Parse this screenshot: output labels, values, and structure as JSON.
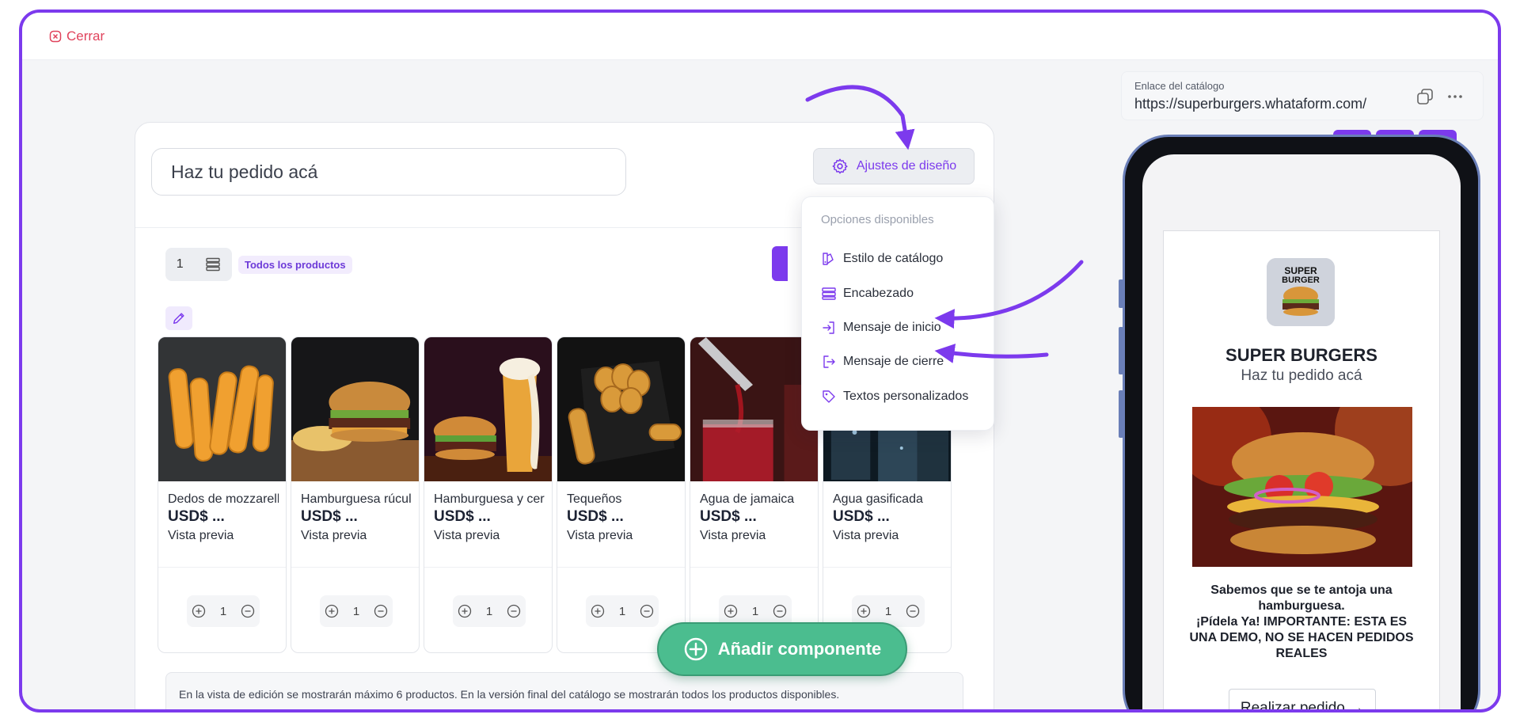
{
  "topbar": {
    "close_label": "Cerrar"
  },
  "editor": {
    "title_value": "Haz tu pedido acá",
    "design_button": "Ajustes de diseño",
    "product_count": "1",
    "filter_tag": "Todos los productos",
    "notice": "En la vista de edición se mostrarán máximo 6 productos. En la versión final del catálogo se mostrarán todos los productos disponibles."
  },
  "dropdown": {
    "header": "Opciones disponibles",
    "items": [
      {
        "label": "Estilo de catálogo",
        "icon": "palette-icon"
      },
      {
        "label": "Encabezado",
        "icon": "header-rows-icon"
      },
      {
        "label": "Mensaje de inicio",
        "icon": "sign-in-icon"
      },
      {
        "label": "Mensaje de cierre",
        "icon": "sign-out-icon"
      },
      {
        "label": "Textos personalizados",
        "icon": "tag-icon"
      }
    ]
  },
  "products": [
    {
      "name": "Dedos de mozzarella",
      "price": "USD$ ...",
      "preview": "Vista previa",
      "qty": "1"
    },
    {
      "name": "Hamburguesa rúcula",
      "price": "USD$ ...",
      "preview": "Vista previa",
      "qty": "1"
    },
    {
      "name": "Hamburguesa y cerveza",
      "price": "USD$ ...",
      "preview": "Vista previa",
      "qty": "1"
    },
    {
      "name": "Tequeños",
      "price": "USD$ ...",
      "preview": "Vista previa",
      "qty": "1"
    },
    {
      "name": "Agua de jamaica",
      "price": "USD$ ...",
      "preview": "Vista previa",
      "qty": "1"
    },
    {
      "name": "Agua gasificada",
      "price": "USD$ ...",
      "preview": "Vista previa",
      "qty": "1"
    }
  ],
  "add_component_label": "Añadir componente",
  "catalog_link": {
    "label": "Enlace del catálogo",
    "url": "https://superburgers.whataform.com/"
  },
  "phone_preview": {
    "logo_text": "SUPER BURGER",
    "store_name": "SUPER BURGERS",
    "store_subtitle": "Haz tu pedido acá",
    "message_line1": "Sabemos que se te antoja una hamburguesa.",
    "message_line2": "¡Pídela Ya! IMPORTANTE: ESTA ES UNA DEMO, NO SE HACEN PEDIDOS REALES",
    "order_button": "Realizar pedido →"
  },
  "colors": {
    "accent": "#7c3aed",
    "close": "#e0435c",
    "add_button": "#4bbd8f"
  }
}
